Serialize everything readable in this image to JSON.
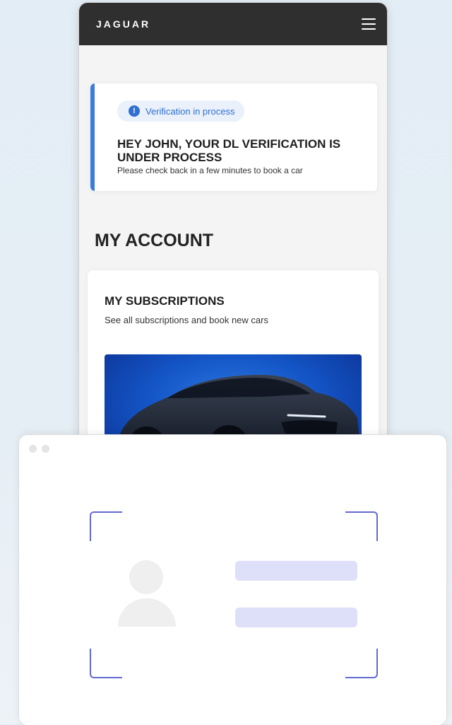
{
  "header": {
    "brand": "JAGUAR",
    "menu_icon": "hamburger-menu-icon"
  },
  "alert": {
    "badge_icon": "info-icon",
    "badge_label": "Verification in process",
    "title": "HEY JOHN, YOUR DL VERIFICATION IS UNDER PROCESS",
    "subtitle": "Please check back in a few minutes to book a car",
    "accent_color": "#3b7ddd"
  },
  "account": {
    "title": "MY ACCOUNT"
  },
  "subscriptions_card": {
    "title": "MY SUBSCRIPTIONS",
    "subtitle": "See all subscriptions and book new cars",
    "image": "car-photo"
  },
  "scanner_window": {
    "frame_color": "#6369d1",
    "placeholder_icon": "person-avatar-icon"
  }
}
